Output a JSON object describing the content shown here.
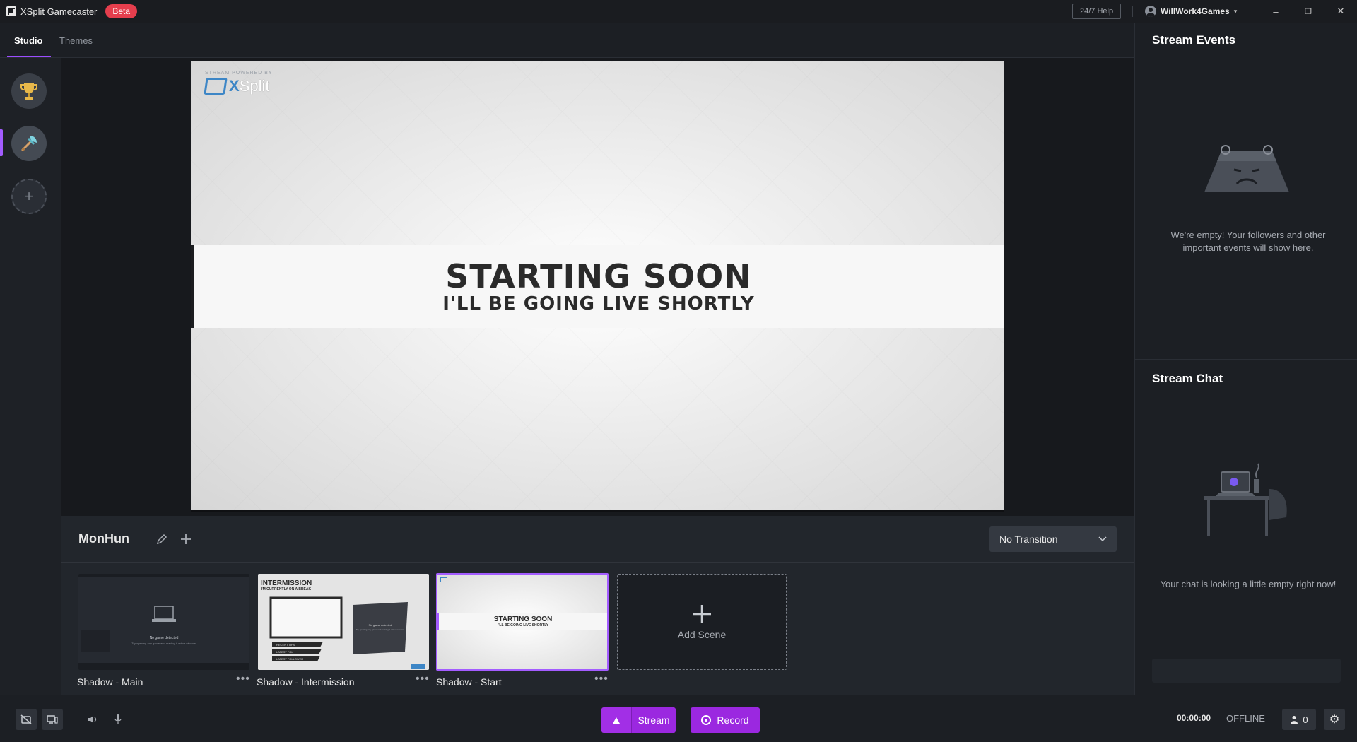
{
  "titlebar": {
    "app_name": "XSplit Gamecaster",
    "beta_label": "Beta",
    "help_label": "24/7 Help",
    "username": "WillWork4Games",
    "minimize": "–",
    "restore": "❐",
    "close": "✕"
  },
  "tabs": [
    {
      "label": "Studio",
      "active": true
    },
    {
      "label": "Themes",
      "active": false
    }
  ],
  "rail": {
    "items": [
      {
        "icon": "trophy-icon"
      },
      {
        "icon": "monster-hunter-icon",
        "active": true
      }
    ],
    "add_symbol": "+"
  },
  "preview": {
    "powered_by": "STREAM POWERED BY",
    "brand_x": "X",
    "brand_split": "Split",
    "headline": "STARTING SOON",
    "subline": "I'LL BE GOING LIVE SHORTLY"
  },
  "scenes": {
    "collection_name": "MonHun",
    "transition": "No Transition",
    "items": [
      {
        "label": "Shadow - Main",
        "caption": "No game detected",
        "detail": "Try opening any game and making it active window.",
        "footer": [
          "",
          "",
          "",
          ""
        ]
      },
      {
        "label": "Shadow - Intermission",
        "title": "INTERMISSION",
        "subtitle": "I'M CURRENTLY ON A BREAK",
        "box_text": "No game detected",
        "box_detail": "Try opening any game and making it active window.",
        "list": [
          "RECENT TIPS",
          "LATEST FOL",
          "LATEST FOLLOWER"
        ]
      },
      {
        "label": "Shadow - Start",
        "headline": "STARTING SOON",
        "subline": "I'LL BE GOING LIVE SHORTLY",
        "selected": true
      }
    ],
    "add_label": "Add Scene",
    "more_label": "•••"
  },
  "right_panel": {
    "events_title": "Stream Events",
    "events_empty": "We're empty! Your followers and other important events will show here.",
    "chat_title": "Stream Chat",
    "chat_empty": "Your chat is looking a little empty right now!"
  },
  "bottombar": {
    "stream_label": "Stream",
    "record_label": "Record",
    "timer": "00:00:00",
    "status": "OFFLINE",
    "viewer_count": "0"
  },
  "colors": {
    "accent": "#9b28e0",
    "beta": "#e53e4d",
    "xsplit_blue": "#3d86c6"
  }
}
